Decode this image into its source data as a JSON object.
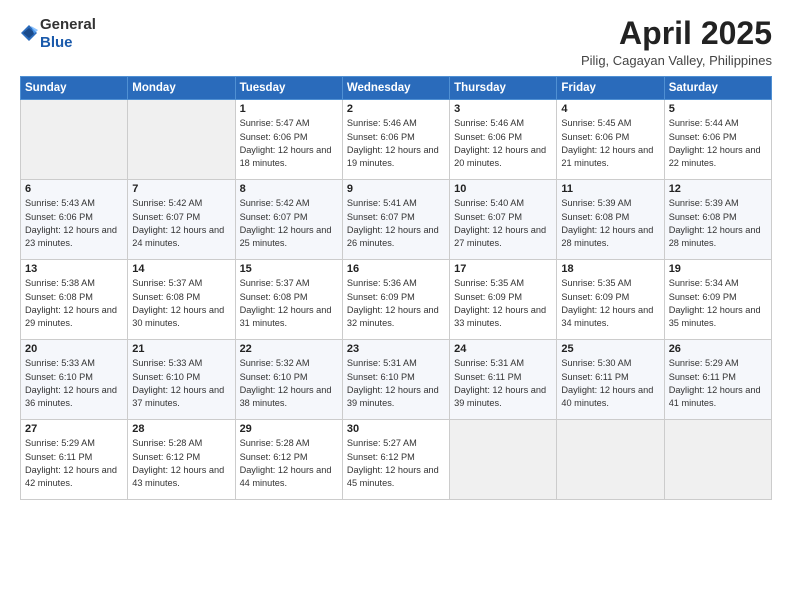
{
  "logo": {
    "general": "General",
    "blue": "Blue"
  },
  "title": "April 2025",
  "subtitle": "Pilig, Cagayan Valley, Philippines",
  "header_days": [
    "Sunday",
    "Monday",
    "Tuesday",
    "Wednesday",
    "Thursday",
    "Friday",
    "Saturday"
  ],
  "weeks": [
    [
      {
        "day": "",
        "sunrise": "",
        "sunset": "",
        "daylight": ""
      },
      {
        "day": "",
        "sunrise": "",
        "sunset": "",
        "daylight": ""
      },
      {
        "day": "1",
        "sunrise": "Sunrise: 5:47 AM",
        "sunset": "Sunset: 6:06 PM",
        "daylight": "Daylight: 12 hours and 18 minutes."
      },
      {
        "day": "2",
        "sunrise": "Sunrise: 5:46 AM",
        "sunset": "Sunset: 6:06 PM",
        "daylight": "Daylight: 12 hours and 19 minutes."
      },
      {
        "day": "3",
        "sunrise": "Sunrise: 5:46 AM",
        "sunset": "Sunset: 6:06 PM",
        "daylight": "Daylight: 12 hours and 20 minutes."
      },
      {
        "day": "4",
        "sunrise": "Sunrise: 5:45 AM",
        "sunset": "Sunset: 6:06 PM",
        "daylight": "Daylight: 12 hours and 21 minutes."
      },
      {
        "day": "5",
        "sunrise": "Sunrise: 5:44 AM",
        "sunset": "Sunset: 6:06 PM",
        "daylight": "Daylight: 12 hours and 22 minutes."
      }
    ],
    [
      {
        "day": "6",
        "sunrise": "Sunrise: 5:43 AM",
        "sunset": "Sunset: 6:06 PM",
        "daylight": "Daylight: 12 hours and 23 minutes."
      },
      {
        "day": "7",
        "sunrise": "Sunrise: 5:42 AM",
        "sunset": "Sunset: 6:07 PM",
        "daylight": "Daylight: 12 hours and 24 minutes."
      },
      {
        "day": "8",
        "sunrise": "Sunrise: 5:42 AM",
        "sunset": "Sunset: 6:07 PM",
        "daylight": "Daylight: 12 hours and 25 minutes."
      },
      {
        "day": "9",
        "sunrise": "Sunrise: 5:41 AM",
        "sunset": "Sunset: 6:07 PM",
        "daylight": "Daylight: 12 hours and 26 minutes."
      },
      {
        "day": "10",
        "sunrise": "Sunrise: 5:40 AM",
        "sunset": "Sunset: 6:07 PM",
        "daylight": "Daylight: 12 hours and 27 minutes."
      },
      {
        "day": "11",
        "sunrise": "Sunrise: 5:39 AM",
        "sunset": "Sunset: 6:08 PM",
        "daylight": "Daylight: 12 hours and 28 minutes."
      },
      {
        "day": "12",
        "sunrise": "Sunrise: 5:39 AM",
        "sunset": "Sunset: 6:08 PM",
        "daylight": "Daylight: 12 hours and 28 minutes."
      }
    ],
    [
      {
        "day": "13",
        "sunrise": "Sunrise: 5:38 AM",
        "sunset": "Sunset: 6:08 PM",
        "daylight": "Daylight: 12 hours and 29 minutes."
      },
      {
        "day": "14",
        "sunrise": "Sunrise: 5:37 AM",
        "sunset": "Sunset: 6:08 PM",
        "daylight": "Daylight: 12 hours and 30 minutes."
      },
      {
        "day": "15",
        "sunrise": "Sunrise: 5:37 AM",
        "sunset": "Sunset: 6:08 PM",
        "daylight": "Daylight: 12 hours and 31 minutes."
      },
      {
        "day": "16",
        "sunrise": "Sunrise: 5:36 AM",
        "sunset": "Sunset: 6:09 PM",
        "daylight": "Daylight: 12 hours and 32 minutes."
      },
      {
        "day": "17",
        "sunrise": "Sunrise: 5:35 AM",
        "sunset": "Sunset: 6:09 PM",
        "daylight": "Daylight: 12 hours and 33 minutes."
      },
      {
        "day": "18",
        "sunrise": "Sunrise: 5:35 AM",
        "sunset": "Sunset: 6:09 PM",
        "daylight": "Daylight: 12 hours and 34 minutes."
      },
      {
        "day": "19",
        "sunrise": "Sunrise: 5:34 AM",
        "sunset": "Sunset: 6:09 PM",
        "daylight": "Daylight: 12 hours and 35 minutes."
      }
    ],
    [
      {
        "day": "20",
        "sunrise": "Sunrise: 5:33 AM",
        "sunset": "Sunset: 6:10 PM",
        "daylight": "Daylight: 12 hours and 36 minutes."
      },
      {
        "day": "21",
        "sunrise": "Sunrise: 5:33 AM",
        "sunset": "Sunset: 6:10 PM",
        "daylight": "Daylight: 12 hours and 37 minutes."
      },
      {
        "day": "22",
        "sunrise": "Sunrise: 5:32 AM",
        "sunset": "Sunset: 6:10 PM",
        "daylight": "Daylight: 12 hours and 38 minutes."
      },
      {
        "day": "23",
        "sunrise": "Sunrise: 5:31 AM",
        "sunset": "Sunset: 6:10 PM",
        "daylight": "Daylight: 12 hours and 39 minutes."
      },
      {
        "day": "24",
        "sunrise": "Sunrise: 5:31 AM",
        "sunset": "Sunset: 6:11 PM",
        "daylight": "Daylight: 12 hours and 39 minutes."
      },
      {
        "day": "25",
        "sunrise": "Sunrise: 5:30 AM",
        "sunset": "Sunset: 6:11 PM",
        "daylight": "Daylight: 12 hours and 40 minutes."
      },
      {
        "day": "26",
        "sunrise": "Sunrise: 5:29 AM",
        "sunset": "Sunset: 6:11 PM",
        "daylight": "Daylight: 12 hours and 41 minutes."
      }
    ],
    [
      {
        "day": "27",
        "sunrise": "Sunrise: 5:29 AM",
        "sunset": "Sunset: 6:11 PM",
        "daylight": "Daylight: 12 hours and 42 minutes."
      },
      {
        "day": "28",
        "sunrise": "Sunrise: 5:28 AM",
        "sunset": "Sunset: 6:12 PM",
        "daylight": "Daylight: 12 hours and 43 minutes."
      },
      {
        "day": "29",
        "sunrise": "Sunrise: 5:28 AM",
        "sunset": "Sunset: 6:12 PM",
        "daylight": "Daylight: 12 hours and 44 minutes."
      },
      {
        "day": "30",
        "sunrise": "Sunrise: 5:27 AM",
        "sunset": "Sunset: 6:12 PM",
        "daylight": "Daylight: 12 hours and 45 minutes."
      },
      {
        "day": "",
        "sunrise": "",
        "sunset": "",
        "daylight": ""
      },
      {
        "day": "",
        "sunrise": "",
        "sunset": "",
        "daylight": ""
      },
      {
        "day": "",
        "sunrise": "",
        "sunset": "",
        "daylight": ""
      }
    ]
  ]
}
